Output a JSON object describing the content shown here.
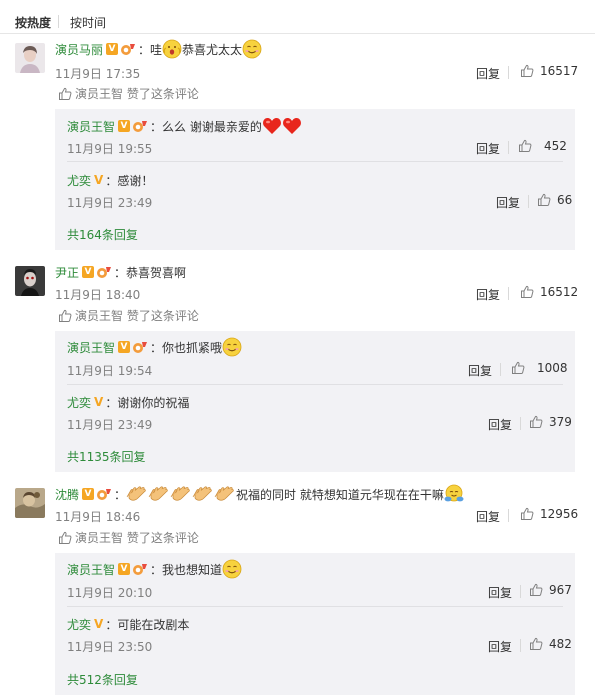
{
  "sort": {
    "hot": "按热度",
    "time": "按时间"
  },
  "comments": [
    {
      "user": "演员马丽",
      "text_prefix": "：哇",
      "text_mid": "恭喜尤太太",
      "time": "11月9日 17:35",
      "reply": "回复",
      "likes": "16517",
      "liked_by": "演员王智 赞了这条评论",
      "subs": [
        {
          "user": "演员王智",
          "text": "：么么 谢谢最亲爱的",
          "time": "11月9日 19:55",
          "reply": "回复",
          "likes": "452"
        },
        {
          "user": "尤奕",
          "text": "：感谢！",
          "time": "11月9日 23:49",
          "reply": "回复",
          "likes": "66"
        }
      ],
      "more": "共164条回复"
    },
    {
      "user": "尹正",
      "text": "：恭喜贺喜啊",
      "time": "11月9日 18:40",
      "reply": "回复",
      "likes": "16512",
      "liked_by": "演员王智 赞了这条评论",
      "subs": [
        {
          "user": "演员王智",
          "text": "：你也抓紧哦",
          "time": "11月9日 19:54",
          "reply": "回复",
          "likes": "1008"
        },
        {
          "user": "尤奕",
          "text": "：谢谢你的祝福",
          "time": "11月9日 23:49",
          "reply": "回复",
          "likes": "379"
        }
      ],
      "more": "共1135条回复"
    },
    {
      "user": "沈腾",
      "text_prefix": "：",
      "text_mid": "祝福的同时 就特想知道元华现在在干嘛",
      "time": "11月9日 18:46",
      "reply": "回复",
      "likes": "12956",
      "liked_by": "演员王智 赞了这条评论",
      "subs": [
        {
          "user": "演员王智",
          "text": "：我也想知道",
          "time": "11月9日 20:10",
          "reply": "回复",
          "likes": "967"
        },
        {
          "user": "尤奕",
          "text": "：可能在改剧本",
          "time": "11月9日 23:50",
          "reply": "回复",
          "likes": "482"
        }
      ],
      "more": "共512条回复"
    }
  ],
  "colors": {
    "name_orange": "#eb7350",
    "name_green": "#2e8b3a",
    "bg_sub": "#f2f2f5",
    "meta_gray": "#808080"
  }
}
